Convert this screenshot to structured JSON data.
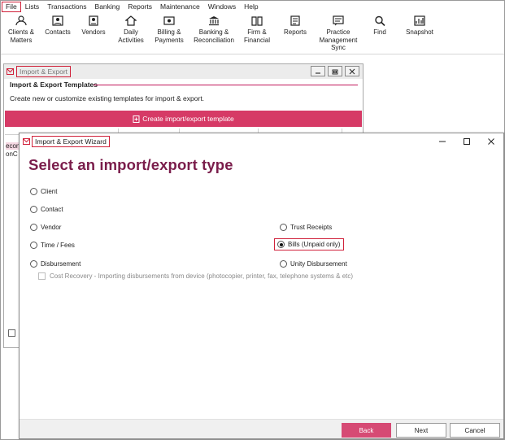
{
  "menu": [
    "File",
    "Lists",
    "Transactions",
    "Banking",
    "Reports",
    "Maintenance",
    "Windows",
    "Help"
  ],
  "toolbar": [
    {
      "label": "Clients &\nMatters",
      "icon": "clients-matters-icon"
    },
    {
      "label": "Contacts",
      "icon": "contacts-icon"
    },
    {
      "label": "Vendors",
      "icon": "vendors-icon"
    },
    {
      "label": "Daily\nActivities",
      "icon": "daily-activities-icon"
    },
    {
      "label": "Billing &\nPayments",
      "icon": "billing-payments-icon"
    },
    {
      "label": "Banking &\nReconciliation",
      "icon": "banking-reconciliation-icon"
    },
    {
      "label": "Firm &\nFinancial",
      "icon": "firm-financial-icon"
    },
    {
      "label": "Reports",
      "icon": "reports-icon"
    },
    {
      "label": "Practice\nManagement\nSync",
      "icon": "practice-management-sync-icon"
    },
    {
      "label": "Find",
      "icon": "find-icon"
    },
    {
      "label": "Snapshot",
      "icon": "snapshot-icon"
    }
  ],
  "bg_window": {
    "title": "Import & Export",
    "heading": "Import & Export Templates",
    "description": "Create new or customize existing templates for import & export.",
    "create_button": "Create import/export template",
    "rows": [
      "econ",
      "onC"
    ]
  },
  "wizard": {
    "title": "Import & Export Wizard",
    "heading": "Select an import/export type",
    "options_left": [
      {
        "label": "Client",
        "selected": false
      },
      {
        "label": "Contact",
        "selected": false
      },
      {
        "label": "Vendor",
        "selected": false
      },
      {
        "label": "Time / Fees",
        "selected": false
      },
      {
        "label": "Disbursement",
        "selected": false
      }
    ],
    "options_right": [
      {
        "label": "Trust Receipts",
        "selected": false
      },
      {
        "label": "Bills (Unpaid only)",
        "selected": true
      },
      {
        "label": "Unity Disbursement",
        "selected": false
      }
    ],
    "sub_option": "Cost Recovery - Importing disbursements from device (photocopier,  printer, fax, telephone systems & etc)",
    "buttons": {
      "back": "Back",
      "next": "Next",
      "cancel": "Cancel"
    }
  },
  "colors": {
    "accent": "#d63a66",
    "heading": "#7a1d4b",
    "highlight": "#d0213a"
  }
}
